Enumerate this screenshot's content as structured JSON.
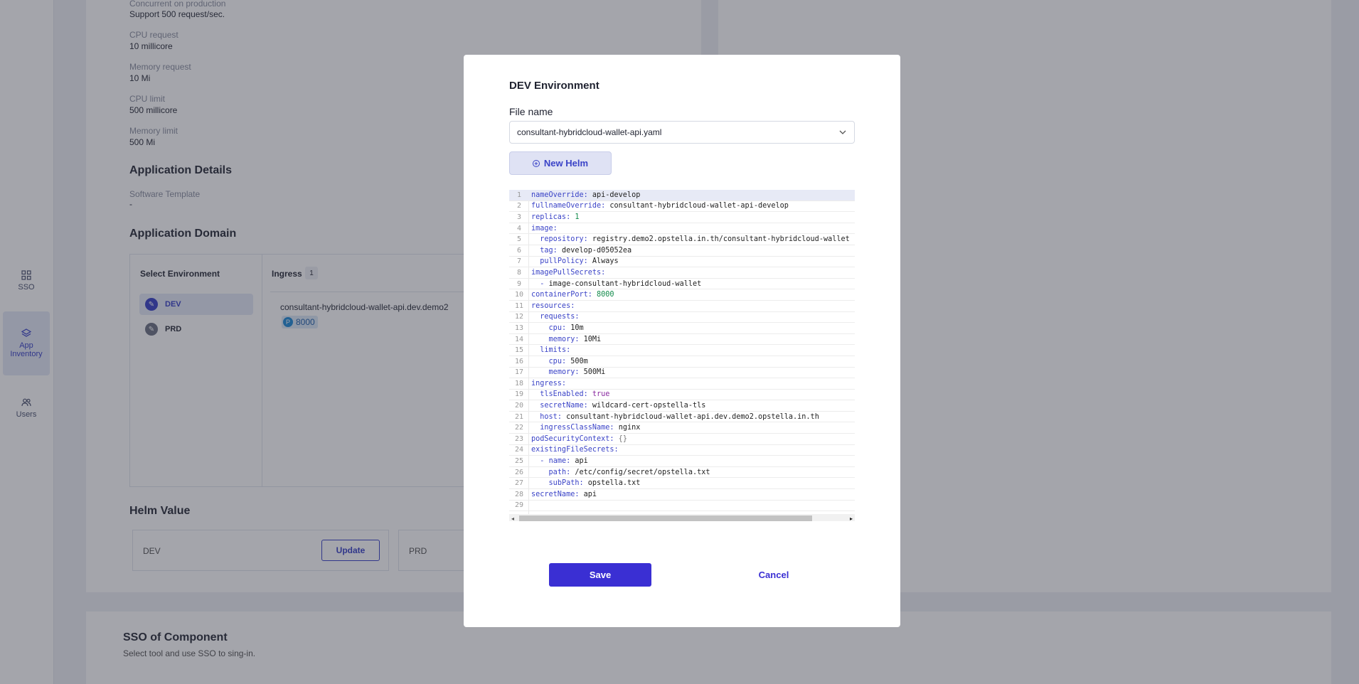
{
  "nav": {
    "items": [
      {
        "label": "SSO",
        "icon": "grid-icon"
      },
      {
        "label": "App Inventory",
        "icon": "layers-icon",
        "active": true
      },
      {
        "label": "Users",
        "icon": "users-icon"
      }
    ]
  },
  "details": {
    "concurrent_label": "Concurrent on production",
    "concurrent_value": "Support 500 request/sec.",
    "cpu_request_label": "CPU request",
    "cpu_request_value": "10 millicore",
    "memory_request_label": "Memory request",
    "memory_request_value": "10 Mi",
    "cpu_limit_label": "CPU limit",
    "cpu_limit_value": "500 millicore",
    "memory_limit_label": "Memory limit",
    "memory_limit_value": "500 Mi"
  },
  "application_details": {
    "title": "Application Details",
    "software_template_label": "Software Template",
    "software_template_value": "-"
  },
  "application_domain": {
    "title": "Application Domain",
    "select_environment": "Select Environment",
    "environments": [
      {
        "name": "DEV",
        "active": true
      },
      {
        "name": "PRD",
        "active": false
      }
    ],
    "ingress_label": "Ingress",
    "ingress_count": "1",
    "ingress_host": "consultant-hybridcloud-wallet-api.dev.demo2",
    "ingress_port": "8000",
    "port_badge_letter": "P"
  },
  "helm_value": {
    "title": "Helm Value",
    "dev_label": "DEV",
    "update_label": "Update",
    "prd_label": "PRD"
  },
  "sso_component": {
    "title": "SSO of Component",
    "subtitle": "Select tool and use SSO to sing-in."
  },
  "modal": {
    "title": "DEV Environment",
    "file_name_label": "File name",
    "file_name_value": "consultant-hybridcloud-wallet-api.yaml",
    "new_helm_label": "New Helm",
    "save_label": "Save",
    "cancel_label": "Cancel",
    "code_lines": [
      {
        "key": "nameOverride",
        "indent": "",
        "prefix": "",
        "value": "api-develop",
        "type": "str"
      },
      {
        "key": "fullnameOverride",
        "indent": "",
        "prefix": "",
        "value": "consultant-hybridcloud-wallet-api-develop",
        "type": "str"
      },
      {
        "key": "replicas",
        "indent": "",
        "prefix": "",
        "value": "1",
        "type": "num"
      },
      {
        "key": "image",
        "indent": "",
        "prefix": "",
        "value": "",
        "type": "str"
      },
      {
        "key": "repository",
        "indent": "  ",
        "prefix": "",
        "value": "registry.demo2.opstella.in.th/consultant-hybridcloud-wallet",
        "type": "str"
      },
      {
        "key": "tag",
        "indent": "  ",
        "prefix": "",
        "value": "develop-d05052ea",
        "type": "str"
      },
      {
        "key": "pullPolicy",
        "indent": "  ",
        "prefix": "",
        "value": "Always",
        "type": "str"
      },
      {
        "key": "imagePullSecrets",
        "indent": "",
        "prefix": "",
        "value": "",
        "type": "str"
      },
      {
        "key": "",
        "indent": "  ",
        "prefix": "- ",
        "value": "image-consultant-hybridcloud-wallet",
        "type": "str"
      },
      {
        "key": "containerPort",
        "indent": "",
        "prefix": "",
        "value": "8000",
        "type": "num"
      },
      {
        "key": "resources",
        "indent": "",
        "prefix": "",
        "value": "",
        "type": "str"
      },
      {
        "key": "requests",
        "indent": "  ",
        "prefix": "",
        "value": "",
        "type": "str"
      },
      {
        "key": "cpu",
        "indent": "    ",
        "prefix": "",
        "value": "10m",
        "type": "str"
      },
      {
        "key": "memory",
        "indent": "    ",
        "prefix": "",
        "value": "10Mi",
        "type": "str"
      },
      {
        "key": "limits",
        "indent": "  ",
        "prefix": "",
        "value": "",
        "type": "str"
      },
      {
        "key": "cpu",
        "indent": "    ",
        "prefix": "",
        "value": "500m",
        "type": "str"
      },
      {
        "key": "memory",
        "indent": "    ",
        "prefix": "",
        "value": "500Mi",
        "type": "str"
      },
      {
        "key": "ingress",
        "indent": "",
        "prefix": "",
        "value": "",
        "type": "str"
      },
      {
        "key": "tlsEnabled",
        "indent": "  ",
        "prefix": "",
        "value": "true",
        "type": "bool"
      },
      {
        "key": "secretName",
        "indent": "  ",
        "prefix": "",
        "value": "wildcard-cert-opstella-tls",
        "type": "str"
      },
      {
        "key": "host",
        "indent": "  ",
        "prefix": "",
        "value": "consultant-hybridcloud-wallet-api.dev.demo2.opstella.in.th",
        "type": "str"
      },
      {
        "key": "ingressClassName",
        "indent": "  ",
        "prefix": "",
        "value": "nginx",
        "type": "str"
      },
      {
        "key": "podSecurityContext",
        "indent": "",
        "prefix": "",
        "value": "{}",
        "type": "sym"
      },
      {
        "key": "existingFileSecrets",
        "indent": "",
        "prefix": "",
        "value": "",
        "type": "str"
      },
      {
        "key": "name",
        "indent": "  ",
        "prefix": "- ",
        "value": "api",
        "type": "str"
      },
      {
        "key": "path",
        "indent": "    ",
        "prefix": "",
        "value": "/etc/config/secret/opstella.txt",
        "type": "str"
      },
      {
        "key": "subPath",
        "indent": "    ",
        "prefix": "",
        "value": "opstella.txt",
        "type": "str"
      },
      {
        "key": "secretName",
        "indent": "",
        "prefix": "",
        "value": "api",
        "type": "str"
      },
      {
        "key": "",
        "indent": "",
        "prefix": "",
        "value": "",
        "type": "str"
      }
    ]
  }
}
